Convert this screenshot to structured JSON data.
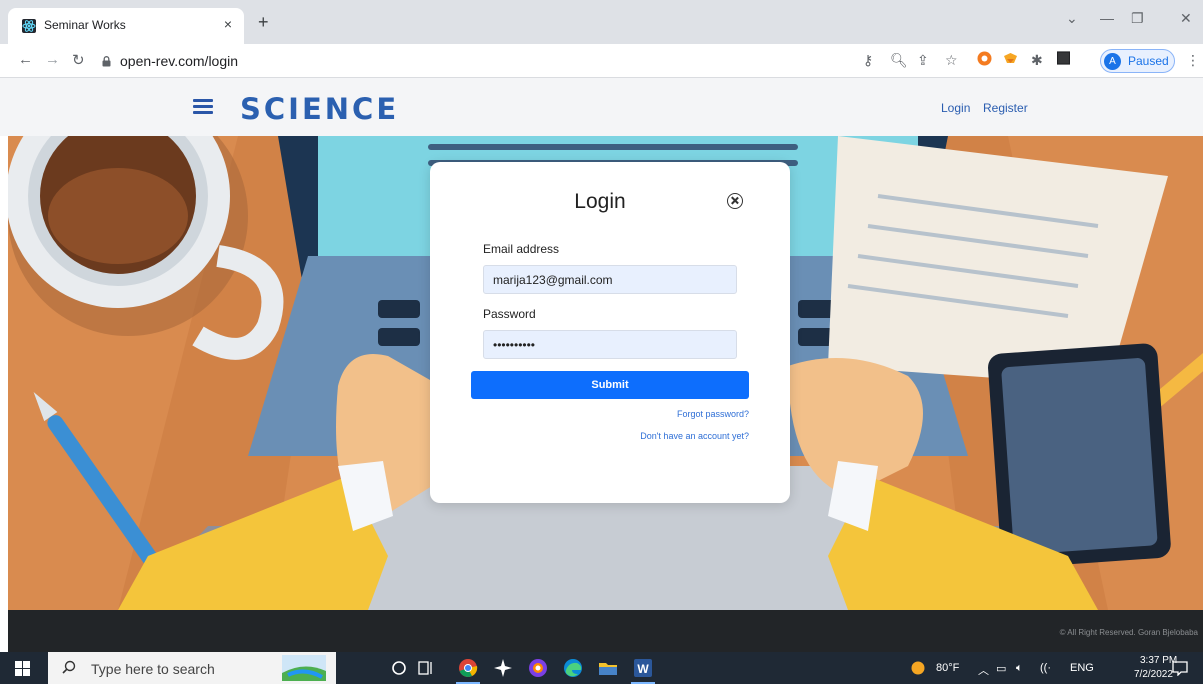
{
  "browser": {
    "tab_title": "Seminar Works",
    "tab_close": "×",
    "new_tab": "+",
    "url": "open-rev.com/login",
    "profile_initial": "A",
    "profile_status": "Paused"
  },
  "site": {
    "logo_text": "SCIENCE",
    "nav": {
      "login": "Login",
      "register": "Register"
    }
  },
  "modal": {
    "title": "Login",
    "email_label": "Email address",
    "email_value": "marija123@gmail.com",
    "password_label": "Password",
    "password_value": "abcdefghij",
    "submit_label": "Submit",
    "forgot_password": "Forgot password?",
    "no_account": "Don't have an account yet?"
  },
  "footer": {
    "copyright": "© All Right Reserved. Goran Bjelobaba"
  },
  "taskbar": {
    "search_placeholder": "Type here to search",
    "weather": "80°F",
    "language": "ENG",
    "time": "3:37 PM",
    "date": "7/2/2022"
  },
  "icons": {
    "browser": [
      "tab-favicon",
      "back-arrow",
      "forward-arrow",
      "reload",
      "lock",
      "key",
      "zoom",
      "share",
      "star",
      "extension-orange",
      "extension-fox",
      "puzzle",
      "sidebar",
      "kebab-menu"
    ],
    "taskbar": [
      "windows-start",
      "search",
      "cortana",
      "task-view",
      "chrome",
      "sparkle-app",
      "vpn",
      "edge",
      "file-explorer",
      "word",
      "notifications"
    ]
  },
  "colors": {
    "accent": "#0d6efd",
    "brand": "#2b60b0",
    "taskbar": "#1f2935"
  }
}
